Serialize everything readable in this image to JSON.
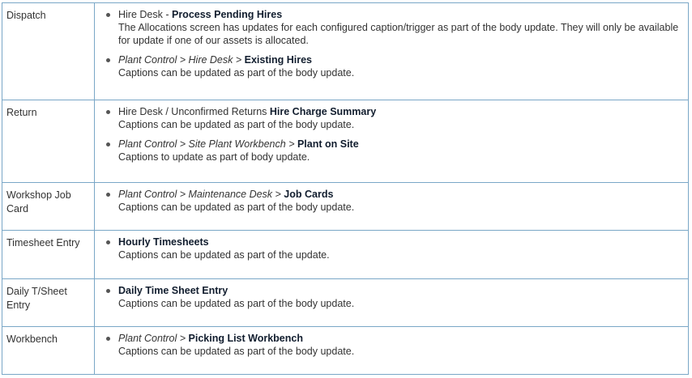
{
  "rows": [
    {
      "label": "Dispatch",
      "items": [
        {
          "path": [
            {
              "t": "Hire Desk",
              "s": "n"
            },
            {
              "t": " - ",
              "s": "n"
            },
            {
              "t": "Process Pending Hires",
              "s": "b"
            }
          ],
          "desc": "The Allocations screen has updates for each configured caption/trigger as part of the body update. They will only be available for update if one of our assets is allocated."
        },
        {
          "path": [
            {
              "t": "Plant Control",
              "s": "i"
            },
            {
              "t": " > ",
              "s": "i"
            },
            {
              "t": "Hire Desk",
              "s": "i"
            },
            {
              "t": " > ",
              "s": "i"
            },
            {
              "t": "Existing Hires",
              "s": "b"
            }
          ],
          "desc": "Captions can be updated as part of the body update."
        }
      ]
    },
    {
      "label": "Return",
      "items": [
        {
          "path": [
            {
              "t": "Hire Desk / Unconfirmed Returns ",
              "s": "n"
            },
            {
              "t": "Hire Charge Summary",
              "s": "b"
            }
          ],
          "desc": "Captions can be updated as part of the body update."
        },
        {
          "path": [
            {
              "t": "Plant Control",
              "s": "i"
            },
            {
              "t": " > ",
              "s": "i"
            },
            {
              "t": "Site Plant Workbench",
              "s": "i"
            },
            {
              "t": " > ",
              "s": "i"
            },
            {
              "t": "Plant on Site",
              "s": "b"
            }
          ],
          "desc": "Captions to update as part of body update."
        }
      ]
    },
    {
      "label": "Workshop Job Card",
      "items": [
        {
          "path": [
            {
              "t": "Plant Control",
              "s": "i"
            },
            {
              "t": " > ",
              "s": "i"
            },
            {
              "t": "Maintenance Desk",
              "s": "i"
            },
            {
              "t": " > ",
              "s": "i"
            },
            {
              "t": "Job Cards",
              "s": "b"
            }
          ],
          "desc": "Captions can be updated as part of the body update."
        }
      ]
    },
    {
      "label": "Timesheet Entry",
      "items": [
        {
          "path": [
            {
              "t": "Hourly Timesheets",
              "s": "b"
            }
          ],
          "desc": "Captions can be updated as part of the update."
        }
      ]
    },
    {
      "label": "Daily T/Sheet Entry",
      "items": [
        {
          "path": [
            {
              "t": "Daily Time Sheet Entry",
              "s": "b"
            }
          ],
          "desc": "Captions can be updated as part of the body update."
        }
      ]
    },
    {
      "label": "Workbench",
      "items": [
        {
          "path": [
            {
              "t": "Plant Control",
              "s": "i"
            },
            {
              "t": " > ",
              "s": "i"
            },
            {
              "t": "Picking List Workbench",
              "s": "b"
            }
          ],
          "desc": "Captions can be updated as part of the body update."
        }
      ]
    }
  ]
}
